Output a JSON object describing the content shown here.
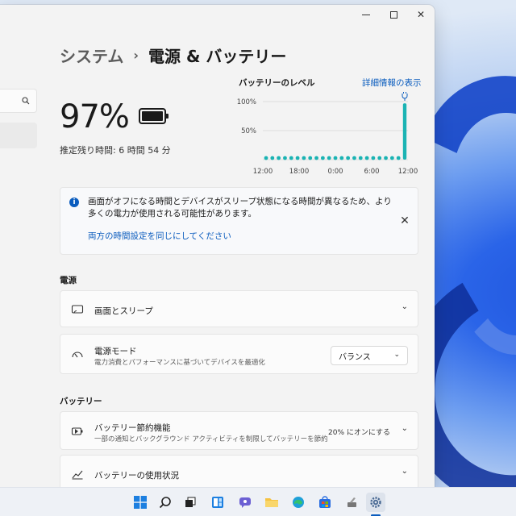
{
  "window": {
    "breadcrumb_parent": "システム",
    "breadcrumb_separator": "›",
    "breadcrumb_current": "電源 & バッテリー",
    "close_glyph": "✕"
  },
  "battery": {
    "percent": "97%",
    "remaining": "推定残り時間: 6 時間 54 分"
  },
  "chart": {
    "title": "バッテリーのレベル",
    "details_link": "詳細情報の表示"
  },
  "chart_data": {
    "type": "bar",
    "title": "バッテリーのレベル",
    "y_ticks": [
      "100%",
      "50%"
    ],
    "x_ticks": [
      "12:00",
      "18:00",
      "0:00",
      "6:00",
      "12:00"
    ],
    "ylim": [
      0,
      100
    ],
    "grid": true,
    "series": [
      {
        "values": [
          0,
          0,
          0,
          0,
          0,
          0,
          0,
          0,
          0,
          0,
          0,
          0,
          0,
          0,
          0,
          0,
          0,
          0,
          0,
          0,
          0,
          0,
          97
        ]
      }
    ],
    "bar_color": "#1ab3b3"
  },
  "notice": {
    "text": "画面がオフになる時間とデバイスがスリープ状態になる時間が異なるため、より多くの電力が使用される可能性があります。",
    "link": "両方の時間設定を同じにしてください",
    "close_glyph": "✕",
    "info_glyph": "i"
  },
  "power_section": {
    "title": "電源",
    "screen_sleep": "画面とスリープ",
    "power_mode_title": "電源モード",
    "power_mode_desc": "電力消費とパフォーマンスに基づいてデバイスを最適化",
    "power_mode_value": "バランス"
  },
  "battery_section": {
    "title": "バッテリー",
    "saver_title": "バッテリー節約機能",
    "saver_desc": "一部の通知とバックグラウンド アクティビティを制限してバッテリーを節約",
    "saver_value": "20% にオンにする",
    "usage_title": "バッテリーの使用状況"
  },
  "chevrons": {
    "down": "⌄"
  },
  "colors": {
    "accent": "#0a5cbe",
    "chart_bar": "#1ab3b3"
  }
}
